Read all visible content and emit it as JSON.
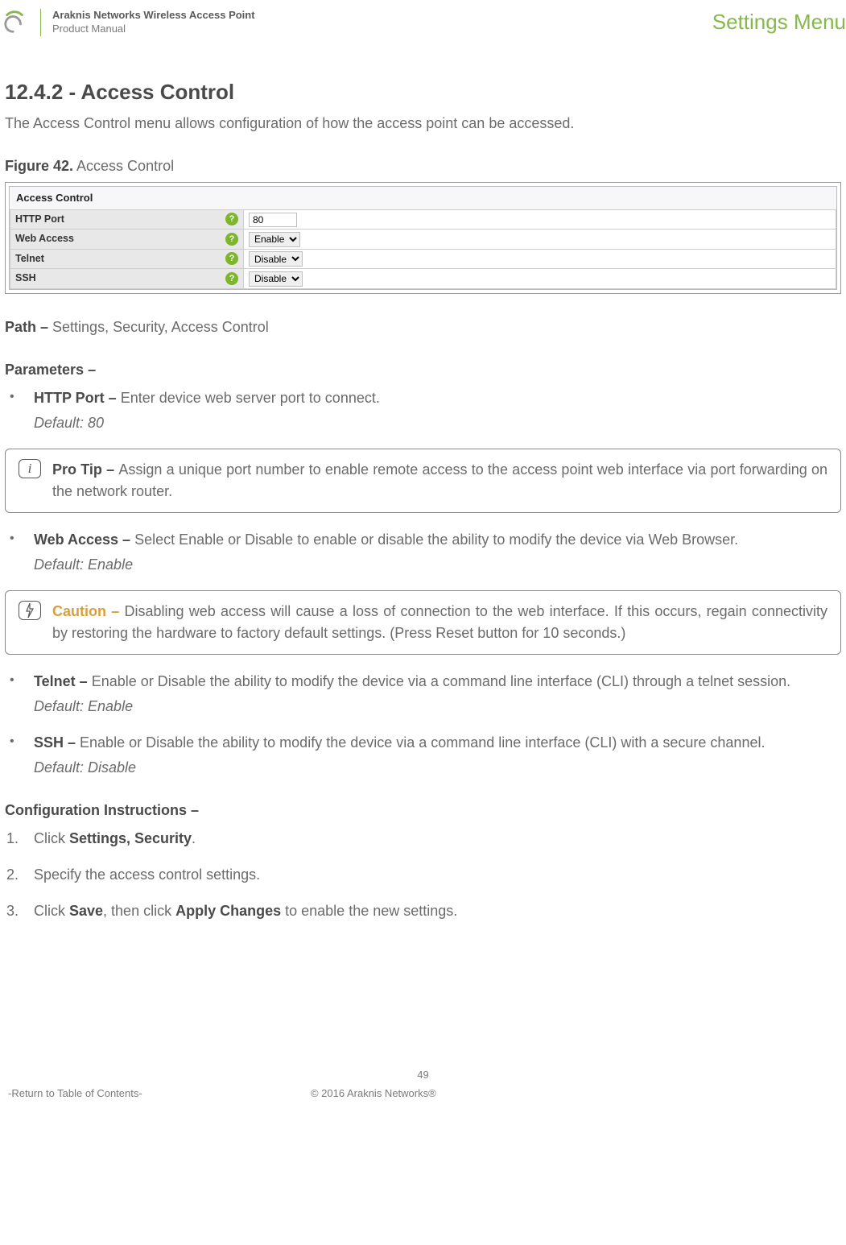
{
  "header": {
    "title_line1": "Araknis Networks Wireless Access Point",
    "title_line2": "Product Manual",
    "menu_label": "Settings Menu"
  },
  "section": {
    "heading": "12.4.2 - Access Control",
    "intro": "The Access Control menu allows configuration of how the access point can be accessed."
  },
  "figure": {
    "label_bold": "Figure 42.",
    "label_rest": " Access Control",
    "panel_title": "Access Control",
    "rows": [
      {
        "label": "HTTP Port",
        "type": "text",
        "value": "80"
      },
      {
        "label": "Web Access",
        "type": "select",
        "value": "Enable"
      },
      {
        "label": "Telnet",
        "type": "select",
        "value": "Disable"
      },
      {
        "label": "SSH",
        "type": "select",
        "value": "Disable"
      }
    ]
  },
  "path": {
    "label": "Path – ",
    "value": "Settings, Security, Access Control"
  },
  "parameters": {
    "heading": "Parameters –",
    "items": [
      {
        "bold": "HTTP Port – ",
        "text": "Enter device web server port to connect.",
        "default": "Default: 80"
      },
      {
        "bold": "Web Access – ",
        "text": "Select Enable or Disable to enable or disable the ability to modify the device via Web Browser.",
        "default": "Default: Enable"
      },
      {
        "bold": "Telnet – ",
        "text": "Enable or Disable the ability to modify the device via a command line interface (CLI) through a telnet session.",
        "default": "Default: Enable"
      },
      {
        "bold": "SSH – ",
        "text": "Enable or Disable the ability to modify the device via a command line interface (CLI) with a secure channel.",
        "default": "Default: Disable"
      }
    ]
  },
  "protip": {
    "icon": "i",
    "bold": "Pro Tip – ",
    "text": "Assign a unique port number to enable remote access to the access point web interface via port forwarding on the network router."
  },
  "caution": {
    "icon": "⚡",
    "bold": "Caution – ",
    "text": "Disabling web access will cause a loss of connection to the web interface. If this occurs, regain connectivity by restoring the hardware to factory default settings. (Press Reset button for 10 seconds.)"
  },
  "config": {
    "heading": "Configuration Instructions –",
    "steps": [
      {
        "pre": "Click ",
        "bold": "Settings, Security",
        "post": "."
      },
      {
        "pre": "Specify the access control settings.",
        "bold": "",
        "post": ""
      },
      {
        "pre": "Click ",
        "bold": "Save",
        "mid": ", then click ",
        "bold2": "Apply Changes",
        "post": " to enable the new settings."
      }
    ]
  },
  "footer": {
    "page": "49",
    "return": "-Return to Table of Contents-",
    "copyright": "© 2016 Araknis Networks®"
  }
}
